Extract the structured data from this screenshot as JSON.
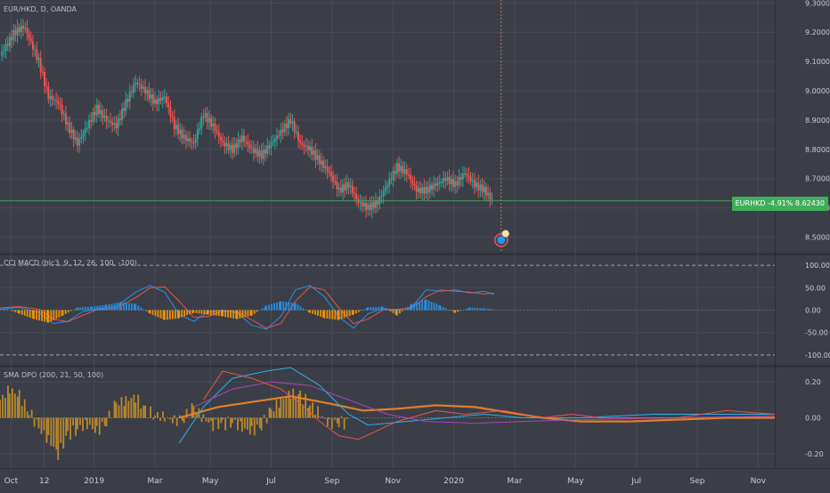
{
  "panes": {
    "price": {
      "title": "EUR/HKD, D, OANDA"
    },
    "cci_macd": {
      "title": "CCI MACD (hlc3, 9, 12, 26, 100, -100)"
    },
    "sma_dpo": {
      "title": "SMA DPO (200, 21, 50, 100)"
    }
  },
  "price_badge": {
    "label": "EURHKD",
    "change": "-4.91%",
    "value": "8.62430"
  },
  "colors": {
    "background": "#3b3e47",
    "grid": "#474b55",
    "bull": "#26a69a",
    "bear": "#ef5350",
    "price_line": "#3fae5a",
    "macd_fast": "#2196f3",
    "macd_slow": "#ef5350",
    "hist_pos": "#2196f3",
    "hist_neg": "#ff9800",
    "dpo_bars": "#c8902a",
    "sma": "#e8822a",
    "dpo_line": "#29b6f6",
    "dpo_signal": "#ab47bc",
    "dpo_red": "#ef5350"
  },
  "chart_data": [
    {
      "type": "candlestick",
      "pane": "price",
      "title": "EUR/HKD, D, OANDA",
      "ylim": [
        8.45,
        9.31
      ],
      "y_ticks": [
        "9.30000",
        "9.20000",
        "9.10000",
        "9.00000",
        "8.90000",
        "8.80000",
        "8.70000",
        "8.60000",
        "8.50000"
      ],
      "last_price": 8.6243,
      "change_pct": -4.91,
      "series": [
        {
          "name": "EURHKD",
          "close_path": [
            [
              0,
              9.12
            ],
            [
              3,
              9.2
            ],
            [
              5,
              9.22
            ],
            [
              8,
              9.1
            ],
            [
              10,
              8.98
            ],
            [
              12,
              8.96
            ],
            [
              14,
              8.88
            ],
            [
              16,
              8.82
            ],
            [
              18,
              8.88
            ],
            [
              20,
              8.94
            ],
            [
              22,
              8.9
            ],
            [
              24,
              8.88
            ],
            [
              26,
              8.96
            ],
            [
              28,
              9.03
            ],
            [
              30,
              9.0
            ],
            [
              32,
              8.96
            ],
            [
              34,
              8.98
            ],
            [
              36,
              8.88
            ],
            [
              38,
              8.84
            ],
            [
              40,
              8.82
            ],
            [
              42,
              8.92
            ],
            [
              44,
              8.88
            ],
            [
              46,
              8.82
            ],
            [
              48,
              8.8
            ],
            [
              50,
              8.84
            ],
            [
              52,
              8.8
            ],
            [
              54,
              8.78
            ],
            [
              56,
              8.82
            ],
            [
              58,
              8.86
            ],
            [
              60,
              8.9
            ],
            [
              62,
              8.82
            ],
            [
              64,
              8.8
            ],
            [
              66,
              8.76
            ],
            [
              68,
              8.72
            ],
            [
              70,
              8.66
            ],
            [
              72,
              8.68
            ],
            [
              74,
              8.62
            ],
            [
              76,
              8.6
            ],
            [
              78,
              8.62
            ],
            [
              80,
              8.68
            ],
            [
              82,
              8.74
            ],
            [
              84,
              8.72
            ],
            [
              86,
              8.66
            ],
            [
              88,
              8.66
            ],
            [
              90,
              8.68
            ],
            [
              92,
              8.7
            ],
            [
              94,
              8.68
            ],
            [
              96,
              8.72
            ],
            [
              98,
              8.68
            ],
            [
              100,
              8.66
            ],
            [
              102,
              8.62
            ]
          ]
        }
      ]
    },
    {
      "type": "line",
      "pane": "cci_macd",
      "title": "CCI MACD (hlc3, 9, 12, 26, 100, -100)",
      "ylim": [
        -120,
        120
      ],
      "y_ticks": [
        "100.00",
        "50.00",
        "0.00",
        "-50.00",
        "-100.00"
      ],
      "series": [
        {
          "name": "macd",
          "values": [
            [
              0,
              2
            ],
            [
              4,
              6
            ],
            [
              8,
              -5
            ],
            [
              11,
              -30
            ],
            [
              14,
              -25
            ],
            [
              17,
              -4
            ],
            [
              20,
              3
            ],
            [
              24,
              8
            ],
            [
              28,
              40
            ],
            [
              31,
              55
            ],
            [
              34,
              40
            ],
            [
              37,
              -10
            ],
            [
              40,
              -25
            ],
            [
              43,
              -4
            ],
            [
              46,
              0
            ],
            [
              49,
              -6
            ],
            [
              52,
              -34
            ],
            [
              55,
              -42
            ],
            [
              58,
              -14
            ],
            [
              61,
              45
            ],
            [
              64,
              55
            ],
            [
              67,
              30
            ],
            [
              70,
              -15
            ],
            [
              73,
              -40
            ],
            [
              76,
              -8
            ],
            [
              79,
              4
            ],
            [
              82,
              0
            ],
            [
              85,
              6
            ],
            [
              88,
              45
            ],
            [
              91,
              42
            ],
            [
              94,
              45
            ],
            [
              97,
              38
            ],
            [
              100,
              42
            ],
            [
              102,
              35
            ]
          ]
        },
        {
          "name": "signal",
          "values": [
            [
              0,
              5
            ],
            [
              4,
              8
            ],
            [
              8,
              2
            ],
            [
              11,
              -20
            ],
            [
              14,
              -26
            ],
            [
              17,
              -12
            ],
            [
              20,
              1
            ],
            [
              24,
              4
            ],
            [
              28,
              28
            ],
            [
              31,
              50
            ],
            [
              34,
              52
            ],
            [
              37,
              20
            ],
            [
              40,
              -16
            ],
            [
              43,
              -14
            ],
            [
              46,
              -2
            ],
            [
              49,
              -4
            ],
            [
              52,
              -22
            ],
            [
              55,
              -40
            ],
            [
              58,
              -30
            ],
            [
              61,
              20
            ],
            [
              64,
              52
            ],
            [
              67,
              45
            ],
            [
              70,
              5
            ],
            [
              73,
              -30
            ],
            [
              76,
              -20
            ],
            [
              79,
              0
            ],
            [
              82,
              2
            ],
            [
              85,
              4
            ],
            [
              88,
              30
            ],
            [
              91,
              45
            ],
            [
              94,
              42
            ],
            [
              97,
              40
            ],
            [
              100,
              36
            ],
            [
              102,
              38
            ]
          ]
        },
        {
          "name": "histogram",
          "values": [
            [
              1,
              4
            ],
            [
              4,
              -8
            ],
            [
              7,
              -20
            ],
            [
              10,
              -28
            ],
            [
              13,
              -12
            ],
            [
              16,
              6
            ],
            [
              19,
              8
            ],
            [
              22,
              12
            ],
            [
              25,
              18
            ],
            [
              28,
              14
            ],
            [
              31,
              -8
            ],
            [
              34,
              -22
            ],
            [
              37,
              -18
            ],
            [
              40,
              -6
            ],
            [
              43,
              -10
            ],
            [
              46,
              -14
            ],
            [
              49,
              -20
            ],
            [
              52,
              -12
            ],
            [
              55,
              10
            ],
            [
              58,
              20
            ],
            [
              61,
              16
            ],
            [
              64,
              -6
            ],
            [
              67,
              -18
            ],
            [
              70,
              -22
            ],
            [
              73,
              -10
            ],
            [
              76,
              6
            ],
            [
              79,
              8
            ],
            [
              82,
              -12
            ],
            [
              85,
              14
            ],
            [
              88,
              24
            ],
            [
              91,
              10
            ],
            [
              94,
              -6
            ],
            [
              97,
              6
            ],
            [
              100,
              4
            ],
            [
              102,
              2
            ]
          ]
        }
      ]
    },
    {
      "type": "line",
      "pane": "sma_dpo",
      "title": "SMA DPO (200, 21, 50, 100)",
      "ylim": [
        -0.26,
        0.28
      ],
      "y_ticks": [
        "0.20",
        "0.00",
        "-0.20"
      ],
      "series": [
        {
          "name": "dpo_histogram",
          "values": [
            [
              0,
              0.1
            ],
            [
              2,
              0.16
            ],
            [
              4,
              0.12
            ],
            [
              6,
              0.04
            ],
            [
              8,
              -0.06
            ],
            [
              10,
              -0.12
            ],
            [
              12,
              -0.2
            ],
            [
              14,
              -0.1
            ],
            [
              16,
              -0.06
            ],
            [
              18,
              -0.04
            ],
            [
              20,
              -0.08
            ],
            [
              22,
              -0.02
            ],
            [
              24,
              0.08
            ],
            [
              26,
              0.1
            ],
            [
              28,
              0.12
            ],
            [
              30,
              0.04
            ],
            [
              32,
              0.02
            ],
            [
              34,
              0.0
            ],
            [
              36,
              -0.02
            ],
            [
              38,
              0.0
            ],
            [
              40,
              0.06
            ],
            [
              42,
              0.0
            ],
            [
              44,
              -0.04
            ],
            [
              46,
              -0.04
            ],
            [
              48,
              -0.02
            ],
            [
              50,
              -0.06
            ],
            [
              52,
              -0.08
            ],
            [
              54,
              -0.04
            ],
            [
              56,
              0.04
            ],
            [
              58,
              0.1
            ],
            [
              60,
              0.14
            ],
            [
              62,
              0.12
            ],
            [
              64,
              0.08
            ],
            [
              66,
              0.02
            ],
            [
              68,
              -0.04
            ],
            [
              70,
              -0.02
            ],
            [
              72,
              -0.04
            ]
          ]
        },
        {
          "name": "sma",
          "values": [
            [
              37,
              0.0
            ],
            [
              45,
              0.06
            ],
            [
              55,
              0.1
            ],
            [
              60,
              0.12
            ],
            [
              68,
              0.08
            ],
            [
              75,
              0.04
            ],
            [
              82,
              0.05
            ],
            [
              90,
              0.07
            ],
            [
              98,
              0.06
            ],
            [
              105,
              0.03
            ],
            [
              112,
              0.0
            ],
            [
              120,
              -0.02
            ],
            [
              130,
              -0.02
            ],
            [
              140,
              -0.01
            ],
            [
              150,
              0.0
            ],
            [
              160,
              0.0
            ]
          ]
        },
        {
          "name": "dpo_line",
          "values": [
            [
              37,
              -0.14
            ],
            [
              42,
              0.06
            ],
            [
              48,
              0.22
            ],
            [
              55,
              0.26
            ],
            [
              60,
              0.28
            ],
            [
              66,
              0.18
            ],
            [
              72,
              0.02
            ],
            [
              76,
              -0.04
            ],
            [
              84,
              -0.02
            ],
            [
              92,
              0.0
            ],
            [
              100,
              0.02
            ],
            [
              108,
              0.0
            ],
            [
              120,
              0.0
            ],
            [
              135,
              0.02
            ],
            [
              150,
              0.02
            ],
            [
              160,
              0.02
            ]
          ]
        },
        {
          "name": "signal_line",
          "values": [
            [
              40,
              0.06
            ],
            [
              48,
              0.16
            ],
            [
              56,
              0.2
            ],
            [
              64,
              0.18
            ],
            [
              72,
              0.1
            ],
            [
              80,
              0.02
            ],
            [
              88,
              -0.02
            ],
            [
              98,
              -0.03
            ],
            [
              108,
              -0.02
            ],
            [
              120,
              -0.01
            ],
            [
              140,
              0.0
            ],
            [
              160,
              0.01
            ]
          ]
        },
        {
          "name": "red_line",
          "values": [
            [
              42,
              0.1
            ],
            [
              46,
              0.26
            ],
            [
              52,
              0.22
            ],
            [
              58,
              0.16
            ],
            [
              62,
              0.08
            ],
            [
              66,
              -0.02
            ],
            [
              70,
              -0.1
            ],
            [
              74,
              -0.12
            ],
            [
              82,
              -0.02
            ],
            [
              90,
              0.04
            ],
            [
              96,
              0.02
            ],
            [
              104,
              0.04
            ],
            [
              112,
              0.0
            ],
            [
              118,
              0.02
            ],
            [
              124,
              0.0
            ],
            [
              140,
              0.0
            ],
            [
              150,
              0.04
            ],
            [
              160,
              0.02
            ]
          ]
        }
      ]
    }
  ],
  "x_axis": {
    "labels": [
      "Oct",
      "12",
      "2019",
      "Mar",
      "May",
      "Jul",
      "Sep",
      "Nov",
      "2020",
      "Mar",
      "May",
      "Jul",
      "Sep",
      "Nov"
    ],
    "positions": [
      2,
      8,
      17,
      28,
      38,
      49,
      60,
      71,
      82,
      93,
      104,
      115,
      126,
      137
    ]
  }
}
